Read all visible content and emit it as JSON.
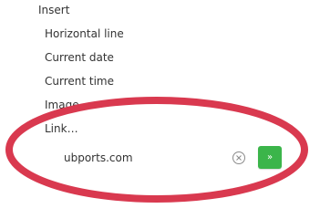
{
  "menu": {
    "header": "Insert",
    "items": [
      {
        "label": "Horizontal line"
      },
      {
        "label": "Current date"
      },
      {
        "label": "Current time"
      },
      {
        "label": "Image…"
      },
      {
        "label": "Link…"
      }
    ]
  },
  "link_input": {
    "value": "ubports.com",
    "clear_icon": "clear-circle-icon"
  },
  "go_button": {
    "label": "»",
    "color": "#3bb54a"
  },
  "annotation": {
    "shape": "ellipse",
    "color": "#d9394f"
  }
}
